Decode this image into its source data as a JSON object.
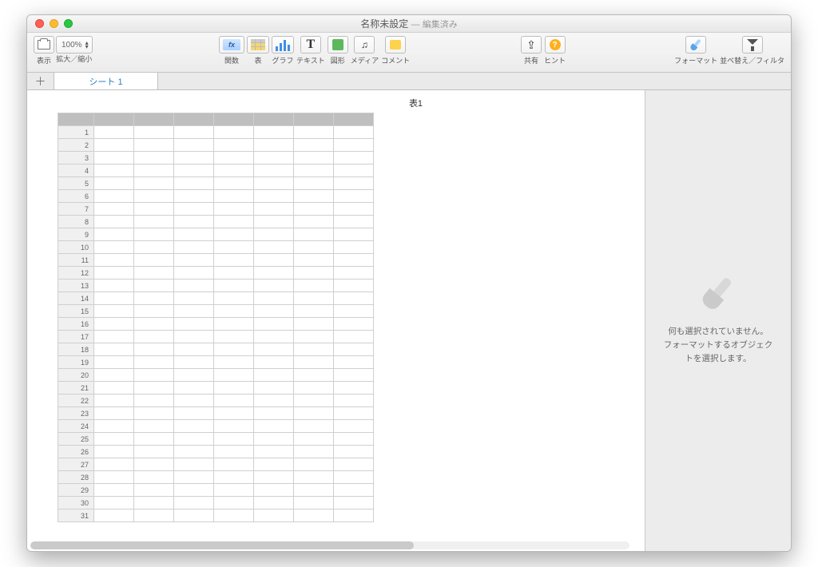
{
  "window": {
    "title": "名称未設定",
    "edited": "— 編集済み"
  },
  "toolbar": {
    "view_label": "表示",
    "zoom_value": "100%",
    "zoom_label": "拡大／縮小",
    "fx_label": "関数",
    "table_label": "表",
    "graph_label": "グラフ",
    "text_label": "テキスト",
    "shape_label": "図形",
    "media_label": "メディア",
    "comment_label": "コメント",
    "share_label": "共有",
    "hint_label": "ヒント",
    "format_label": "フォーマット",
    "sortfilter_label": "並べ替え／フィルタ"
  },
  "tabs": {
    "sheet1": "シート 1"
  },
  "sheet": {
    "title": "表1",
    "rows": 31,
    "columns": 7
  },
  "inspector": {
    "line1": "何も選択されていません。",
    "line2": "フォーマットするオブジェクトを選択します。"
  }
}
